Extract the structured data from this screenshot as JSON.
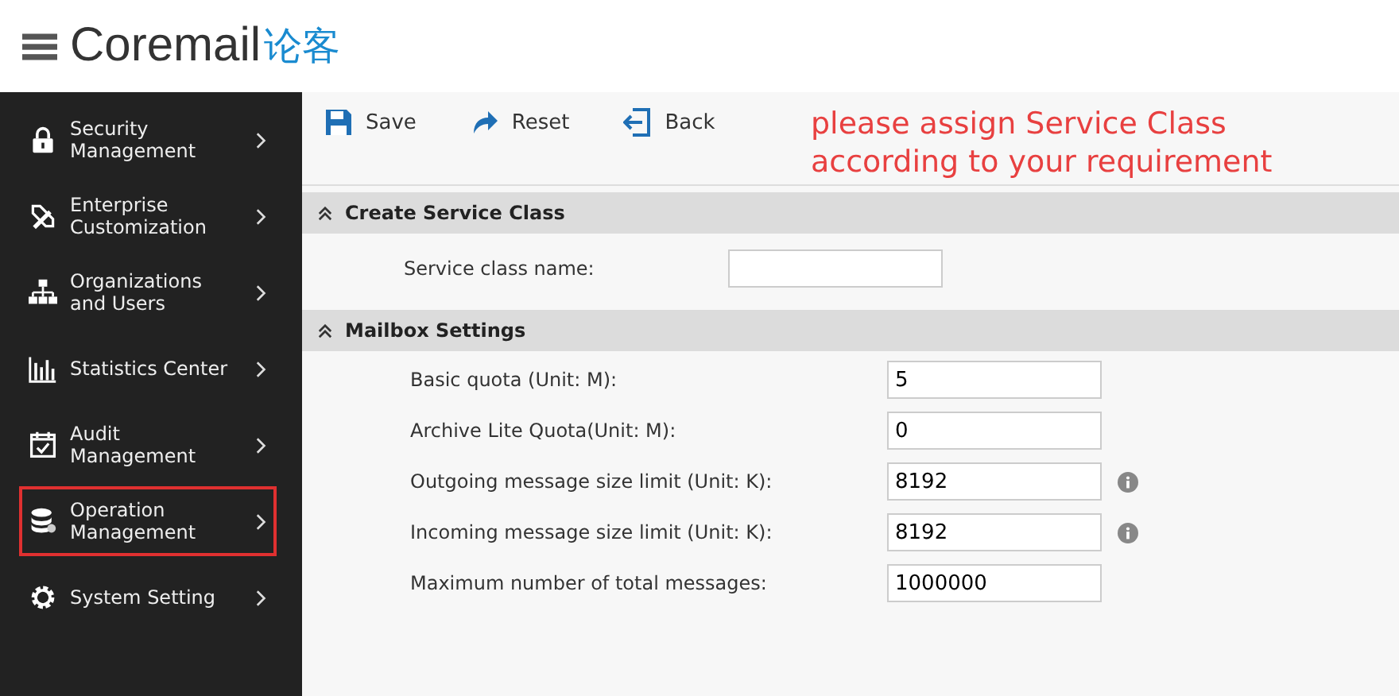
{
  "header": {
    "logo_text": "Coremail",
    "logo_cn": "论客"
  },
  "sidebar": {
    "items": [
      {
        "label": "Security Management",
        "highlighted": false
      },
      {
        "label": "Enterprise Customization",
        "highlighted": false
      },
      {
        "label": "Organizations and Users",
        "highlighted": false
      },
      {
        "label": "Statistics Center",
        "highlighted": false
      },
      {
        "label": "Audit Management",
        "highlighted": false
      },
      {
        "label": "Operation Management",
        "highlighted": true
      },
      {
        "label": "System Setting",
        "highlighted": false
      }
    ]
  },
  "toolbar": [
    {
      "label": "Save"
    },
    {
      "label": "Reset"
    },
    {
      "label": "Back"
    }
  ],
  "annotation": "please assign Service Class according to your requirement",
  "sections": [
    {
      "title": "Create Service Class",
      "fields": [
        {
          "label": "Service class name:",
          "info": false
        }
      ]
    },
    {
      "title": "Mailbox Settings",
      "fields": [
        {
          "label": "Basic quota (Unit: M):",
          "value": "5",
          "info": false
        },
        {
          "label": "Archive Lite Quota(Unit: M):",
          "value": "0",
          "info": false
        },
        {
          "label": "Outgoing message size limit (Unit: K):",
          "value": "8192",
          "info": true
        },
        {
          "label": "Incoming message size limit (Unit: K):",
          "value": "8192",
          "info": true
        },
        {
          "label": "Maximum number of total messages:",
          "value": "1000000",
          "info": false
        }
      ]
    }
  ]
}
